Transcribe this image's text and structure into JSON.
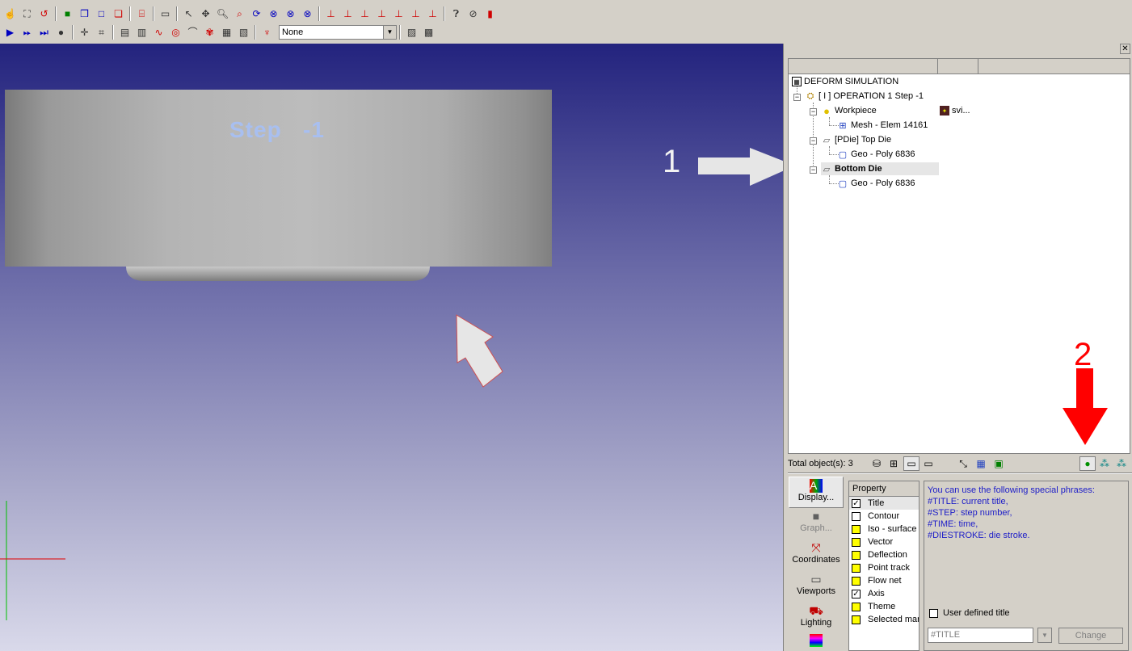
{
  "toolbar1": {
    "icons": [
      "pointer-icon",
      "fit-icon",
      "undo-view-icon",
      "solid-cube-icon",
      "wire-cube-icon",
      "outline-cube-icon",
      "red-cube-icon",
      "cylinder-icon",
      "ruler-icon",
      "select-arrow-icon",
      "pan-icon",
      "zoom-icon",
      "zoom-box-icon",
      "rotate-icon",
      "rotate-x-icon",
      "rotate-y-icon",
      "rotate-z-icon",
      "view-x-plus-icon",
      "view-x-minus-icon",
      "view-y-plus-icon",
      "view-y-minus-icon",
      "view-z-plus-icon",
      "view-z-minus-icon",
      "view-iso-icon",
      "help-icon",
      "stop-icon",
      "exit-icon"
    ]
  },
  "toolbar2": {
    "combo_value": "None"
  },
  "viewport": {
    "step_title": "Step   -1",
    "annotation_1": "1",
    "colors": {
      "bg_top": "#23237e",
      "bg_bottom": "#d9d9ea",
      "title": "#a8bff0",
      "arrow": "#e6e6e6"
    }
  },
  "tree": {
    "root": "DEFORM SIMULATION",
    "operation": "[ I ]  OPERATION 1  Step -1",
    "workpiece": "Workpiece",
    "workpiece_extra": "svi...",
    "mesh": "Mesh - Elem 14161",
    "top_die": "[PDie] Top Die",
    "top_die_geo": "Geo - Poly 6836",
    "bottom_die": "Bottom Die",
    "bottom_die_geo": "Geo - Poly 6836"
  },
  "status": {
    "total_objects": "Total object(s): 3",
    "annotation_2": "2",
    "annotation_color": "#ff0000"
  },
  "left_panel": {
    "items": [
      {
        "label": "Display...",
        "icon": "display-icon"
      },
      {
        "label": "Graph...",
        "icon": "graph-icon"
      },
      {
        "label": "Coordinates",
        "icon": "coordinates-icon"
      },
      {
        "label": "Viewports",
        "icon": "viewports-icon"
      },
      {
        "label": "Lighting",
        "icon": "lighting-icon"
      }
    ]
  },
  "properties": {
    "header": "Property",
    "items": [
      {
        "label": "Title",
        "state": "checked"
      },
      {
        "label": "Contour",
        "state": "unchecked"
      },
      {
        "label": "Iso - surface",
        "state": "yellow"
      },
      {
        "label": "Vector",
        "state": "yellow"
      },
      {
        "label": "Deflection",
        "state": "yellow"
      },
      {
        "label": "Point track",
        "state": "yellow"
      },
      {
        "label": "Flow net",
        "state": "yellow"
      },
      {
        "label": "Axis",
        "state": "checked"
      },
      {
        "label": "Theme",
        "state": "yellow"
      },
      {
        "label": "Selected mar",
        "state": "yellow"
      }
    ]
  },
  "help": {
    "lines": [
      "You can use the following special phrases:",
      "#TITLE: current title,",
      "#STEP: step number,",
      "#TIME: time,",
      "#DIESTROKE: die stroke."
    ],
    "user_defined_label": "User defined title",
    "title_value": "#TITLE",
    "change_label": "Change"
  }
}
